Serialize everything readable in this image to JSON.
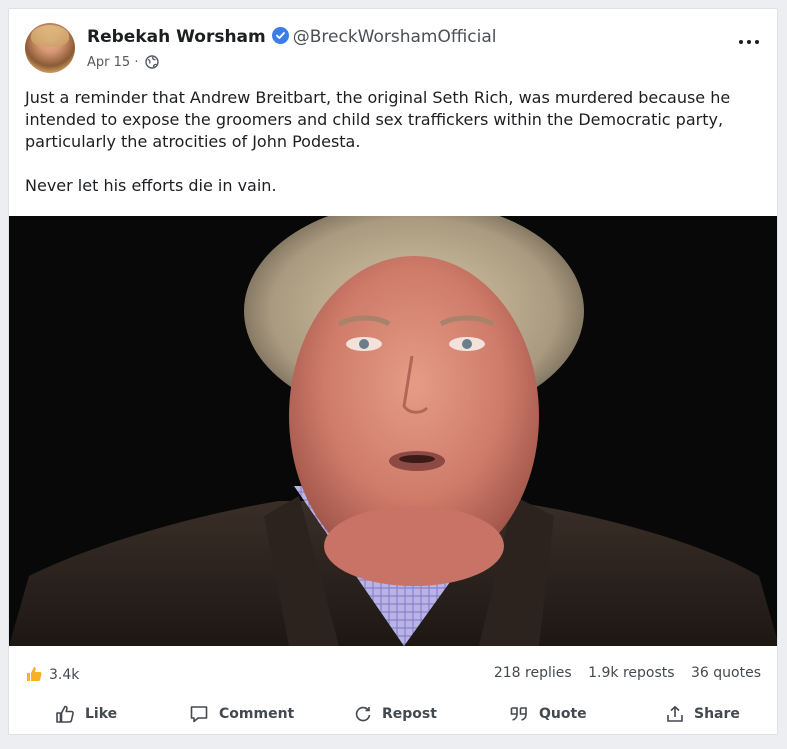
{
  "post": {
    "author_name": "Rebekah Worsham",
    "handle": "@BreckWorshamOfficial",
    "date": "Apr 15",
    "meta_separator": "·",
    "visibility_icon": "globe-icon",
    "verified_icon": "verified-badge-icon",
    "paragraphs": [
      "Just a reminder that Andrew Breitbart, the original Seth Rich, was murdered because he intended to expose the groomers and child sex traffickers within the Democratic party, particularly the atrocities of John Podesta.",
      "Never let his efforts die in vain."
    ]
  },
  "stats": {
    "reaction_icon": "thumbs-up-icon",
    "reaction_count": "3.4k",
    "replies": "218 replies",
    "reposts": "1.9k reposts",
    "quotes": "36 quotes"
  },
  "actions": {
    "like": "Like",
    "comment": "Comment",
    "repost": "Repost",
    "quote": "Quote",
    "share": "Share"
  },
  "colors": {
    "verified": "#3b7de9",
    "reaction": "#f7b125",
    "background": "#eceef1"
  }
}
